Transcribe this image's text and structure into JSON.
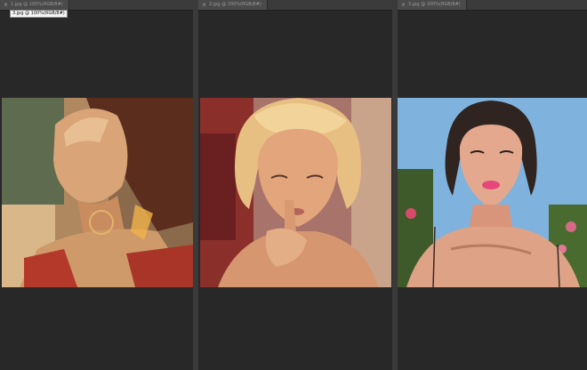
{
  "panels": [
    {
      "tab_title": "1.jpg @ 100%(RGB/8#)",
      "close_glyph": "×"
    },
    {
      "tab_title": "2.jpg @ 100%(RGB/8#)",
      "close_glyph": "×"
    },
    {
      "tab_title": "3.jpg @ 100%(RGB/8#)",
      "close_glyph": "×"
    }
  ],
  "tooltip": {
    "text": "3.jpg @ 100%(RGB/8#)"
  },
  "images": [
    {
      "name": "woman-profile-warm-light",
      "palette": [
        "#c9a06a",
        "#6b3d26",
        "#b53a2c",
        "#e9c39a"
      ]
    },
    {
      "name": "blonde-woman-finger-lips",
      "palette": [
        "#d8a57a",
        "#8a4a3c",
        "#f0cf99",
        "#b57a58"
      ]
    },
    {
      "name": "brunette-woman-blue-sky",
      "palette": [
        "#7fb3dd",
        "#3a2a22",
        "#e89d8a",
        "#d46a86"
      ]
    }
  ]
}
